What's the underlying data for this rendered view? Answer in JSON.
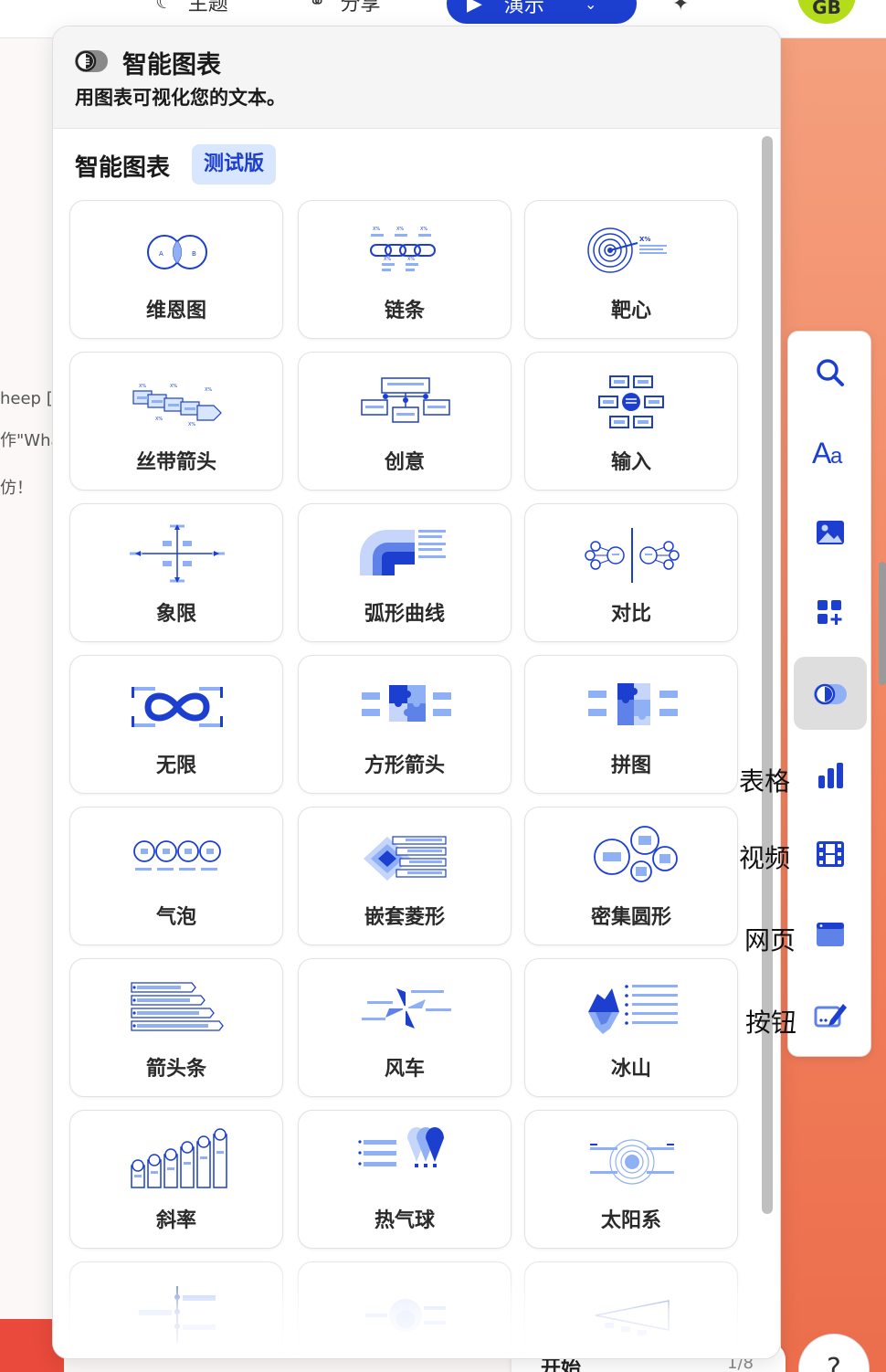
{
  "topbar": {
    "theme_label": "主题",
    "share_label": "分享",
    "present_label": "演示",
    "avatar_initials": "GB"
  },
  "background": {
    "line1": "heep [",
    "line2": "作\"Wha",
    "line3": "仿！",
    "bottom_text": "开始",
    "page_indicator": "1/8",
    "help": "?"
  },
  "panel": {
    "title": "智能图表",
    "description": "用图表可视化您的文本。",
    "section_title": "智能图表",
    "beta_badge": "测试版",
    "cards": [
      {
        "label": "维恩图",
        "icon": "venn-icon"
      },
      {
        "label": "链条",
        "icon": "chain-icon"
      },
      {
        "label": "靶心",
        "icon": "target-icon"
      },
      {
        "label": "丝带箭头",
        "icon": "ribbon-arrow-icon"
      },
      {
        "label": "创意",
        "icon": "creative-icon"
      },
      {
        "label": "输入",
        "icon": "input-icon"
      },
      {
        "label": "象限",
        "icon": "quadrant-icon"
      },
      {
        "label": "弧形曲线",
        "icon": "arc-curve-icon"
      },
      {
        "label": "对比",
        "icon": "compare-icon"
      },
      {
        "label": "无限",
        "icon": "infinity-icon"
      },
      {
        "label": "方形箭头",
        "icon": "square-arrow-icon"
      },
      {
        "label": "拼图",
        "icon": "puzzle-icon"
      },
      {
        "label": "气泡",
        "icon": "bubble-icon"
      },
      {
        "label": "嵌套菱形",
        "icon": "nested-diamond-icon"
      },
      {
        "label": "密集圆形",
        "icon": "dense-circle-icon"
      },
      {
        "label": "箭头条",
        "icon": "arrow-bar-icon"
      },
      {
        "label": "风车",
        "icon": "windmill-icon"
      },
      {
        "label": "冰山",
        "icon": "iceberg-icon"
      },
      {
        "label": "斜率",
        "icon": "slope-icon"
      },
      {
        "label": "热气球",
        "icon": "hot-air-balloon-icon"
      },
      {
        "label": "太阳系",
        "icon": "solar-system-icon"
      }
    ]
  },
  "toolbar": {
    "tools": [
      {
        "name": "search",
        "icon": "search-icon",
        "label": ""
      },
      {
        "name": "text",
        "icon": "text-icon",
        "label": ""
      },
      {
        "name": "image",
        "icon": "image-icon",
        "label": ""
      },
      {
        "name": "apps",
        "icon": "apps-add-icon",
        "label": ""
      },
      {
        "name": "smart-chart",
        "icon": "smart-chart-icon",
        "label": ""
      },
      {
        "name": "table",
        "icon": "bar-chart-icon",
        "label": "表格"
      },
      {
        "name": "video",
        "icon": "video-icon",
        "label": "视频"
      },
      {
        "name": "webpage",
        "icon": "webpage-icon",
        "label": "网页"
      },
      {
        "name": "button",
        "icon": "button-edit-icon",
        "label": "按钮"
      }
    ]
  },
  "colors": {
    "accent": "#1c3fd0",
    "light_accent": "#8fb0f5",
    "badge_bg": "#d9e6ff",
    "avatar": "#b4dc1a"
  }
}
